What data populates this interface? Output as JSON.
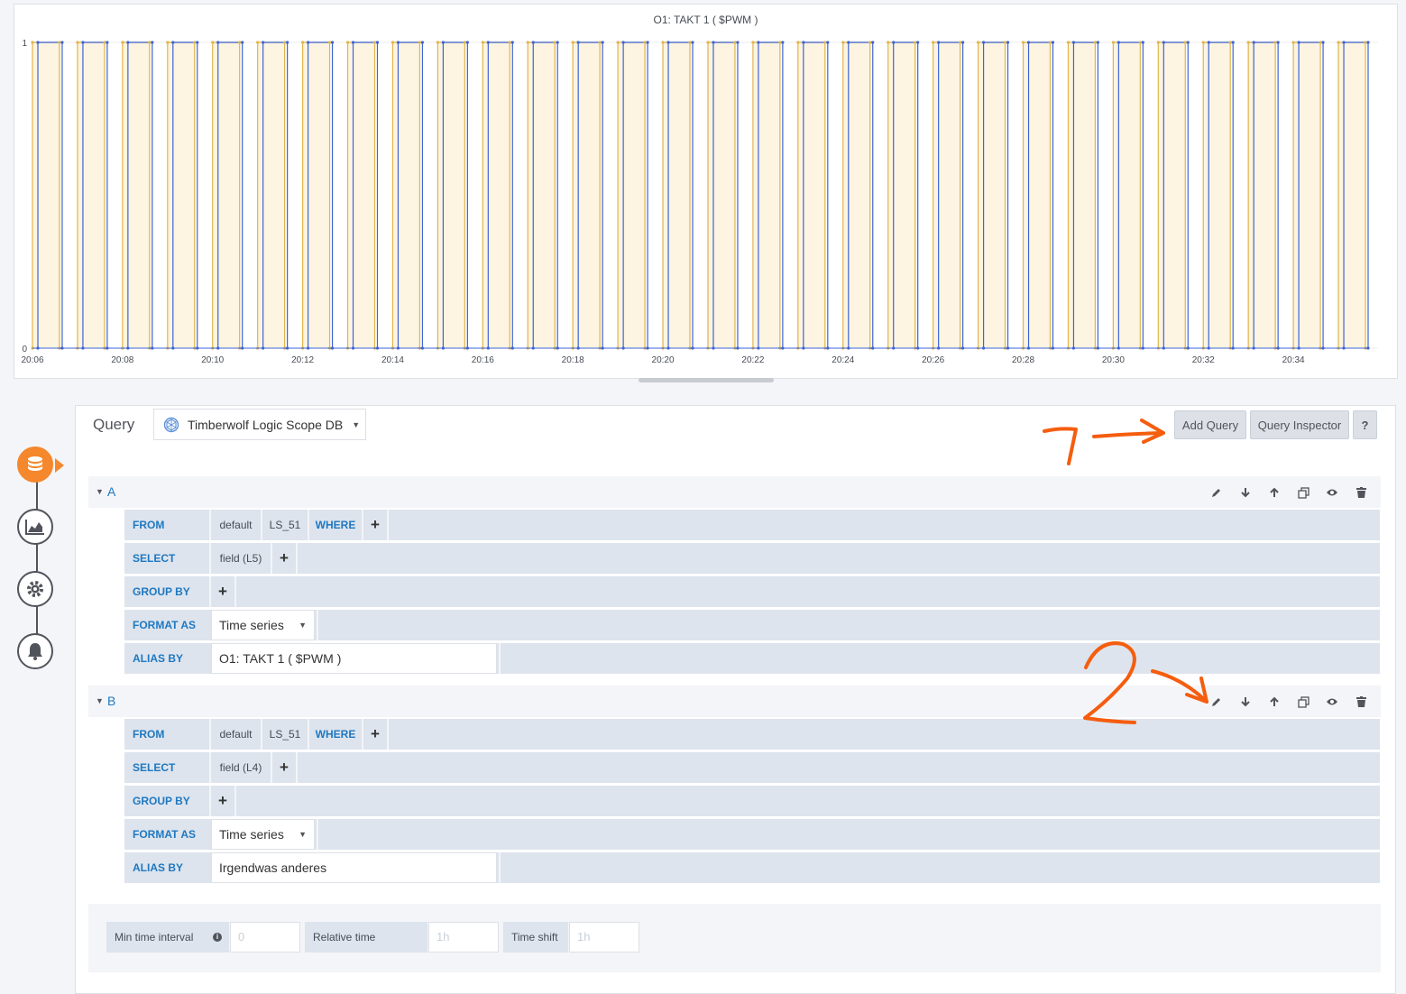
{
  "panel": {
    "title": "O1: TAKT 1 ( $PWM )"
  },
  "chart_data": {
    "type": "line",
    "title": "O1: TAKT 1 ( $PWM )",
    "y_ticks": [
      "1",
      "0"
    ],
    "ylim": [
      0,
      1
    ],
    "x_ticks": [
      "20:06",
      "20:08",
      "20:10",
      "20:12",
      "20:14",
      "20:16",
      "20:18",
      "20:20",
      "20:22",
      "20:24",
      "20:26",
      "20:28",
      "20:30",
      "20:32",
      "20:34"
    ],
    "xlim_minutes": [
      0,
      29.6
    ],
    "pulse_period_minutes": 1,
    "pulse_width_minutes": 0.6,
    "series": [
      {
        "name": "O1: TAKT 1 ( $PWM )",
        "color": "#e0b54b",
        "fill": "#fdf4e1",
        "values": "square wave 0/1"
      },
      {
        "name": "Irgendwas anderes",
        "color": "#3d64d8",
        "values": "square wave 0/1"
      }
    ],
    "grid": true
  },
  "query": {
    "title": "Query",
    "datasource": "Timberwolf Logic Scope DB",
    "add_query": "Add Query",
    "query_inspector": "Query Inspector",
    "help": "?"
  },
  "queries": [
    {
      "refid": "A",
      "from_label": "FROM",
      "db": "default",
      "measurement": "LS_51",
      "where": "WHERE",
      "select_label": "SELECT",
      "field": "field (L5)",
      "group_label": "GROUP BY",
      "format_label": "FORMAT AS",
      "format": "Time series",
      "alias_label": "ALIAS BY",
      "alias": "O1: TAKT 1 ( $PWM )"
    },
    {
      "refid": "B",
      "from_label": "FROM",
      "db": "default",
      "measurement": "LS_51",
      "where": "WHERE",
      "select_label": "SELECT",
      "field": "field (L4)",
      "group_label": "GROUP BY",
      "format_label": "FORMAT AS",
      "format": "Time series",
      "alias_label": "ALIAS BY",
      "alias": "Irgendwas anderes"
    }
  ],
  "plus": "+",
  "options": {
    "min_interval_label": "Min time interval",
    "min_interval_placeholder": "0",
    "relative_time_label": "Relative time",
    "relative_time_placeholder": "1h",
    "time_shift_label": "Time shift",
    "time_shift_placeholder": "1h"
  },
  "icons": {
    "rail": [
      "database-icon",
      "chart-area-icon",
      "gear-icon",
      "bell-icon"
    ],
    "query_actions": [
      "pencil-icon",
      "arrow-down-icon",
      "arrow-up-icon",
      "duplicate-icon",
      "eye-icon",
      "trash-icon"
    ]
  },
  "colors": {
    "accent": "#f5872c",
    "link": "#1f78c1",
    "annotation": "#f55d0f"
  },
  "annotations": [
    "1",
    "2"
  ]
}
